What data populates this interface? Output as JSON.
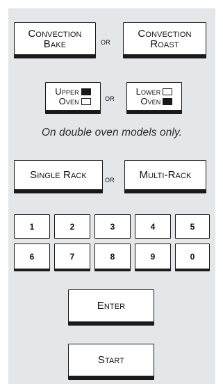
{
  "cooking_mode": {
    "convection_bake": [
      "Convection",
      "Bake"
    ],
    "or": "or",
    "convection_roast": [
      "Convection",
      "Roast"
    ]
  },
  "oven_select": {
    "upper_oven": [
      "Upper",
      "Oven"
    ],
    "or": "or",
    "lower_oven": [
      "Lower",
      "Oven"
    ],
    "note": "On double oven models only."
  },
  "rack_mode": {
    "single_rack": "Single Rack",
    "or": "or",
    "multi_rack": "Multi-Rack"
  },
  "keypad": {
    "row1": [
      "1",
      "2",
      "3",
      "4",
      "5"
    ],
    "row2": [
      "6",
      "7",
      "8",
      "9",
      "0"
    ]
  },
  "actions": {
    "enter": "Enter",
    "start": "Start"
  },
  "colors": {
    "panel_bg": "#e5e6e8",
    "key_border": "#1a1a1a"
  },
  "icons": {
    "upper_indicator": "filled-square-icon",
    "lower_indicator": "filled-square-icon"
  }
}
